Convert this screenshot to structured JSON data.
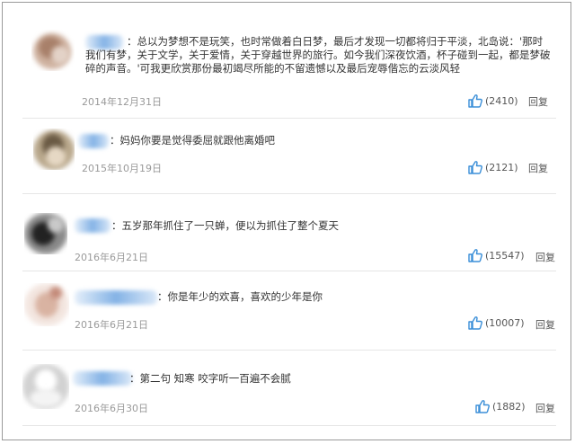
{
  "comments": [
    {
      "text": "：总以为梦想不是玩笑，也时常做着白日梦，最后才发现一切都将归于平淡，北岛说：'那时我们有梦，关于文学，关于爱情，关于穿越世界的旅行。如今我们深夜饮酒，杯子碰到一起，都是梦破碎的声音。'可我更欣赏那份最初竭尽所能的不留遗憾以及最后宠辱偕忘的云淡风轻",
      "date": "2014年12月31日",
      "likes": "(2410)",
      "reply": "回复"
    },
    {
      "text": "：妈妈你要是觉得委屈就跟他离婚吧",
      "date": "2015年10月19日",
      "likes": "(2121)",
      "reply": "回复"
    },
    {
      "text": "：五岁那年抓住了一只蝉，便以为抓住了整个夏天",
      "date": "2016年6月21日",
      "likes": "(15547)",
      "reply": "回复"
    },
    {
      "text": "：你是年少的欢喜，喜欢的少年是你",
      "date": "2016年6月21日",
      "likes": "(10007)",
      "reply": "回复"
    },
    {
      "text": "：第二句 知寒 咬字听一百遍不会腻",
      "date": "2016年6月30日",
      "likes": "(1882)",
      "reply": "回复"
    }
  ],
  "colors": {
    "text": "#333333",
    "meta": "#9a9a9a",
    "like_icon": "#3b8fd8",
    "username_blur": "#6ea5e1"
  },
  "icons": {
    "like": "thumbs-up-icon",
    "avatar": "blurred-avatar"
  }
}
